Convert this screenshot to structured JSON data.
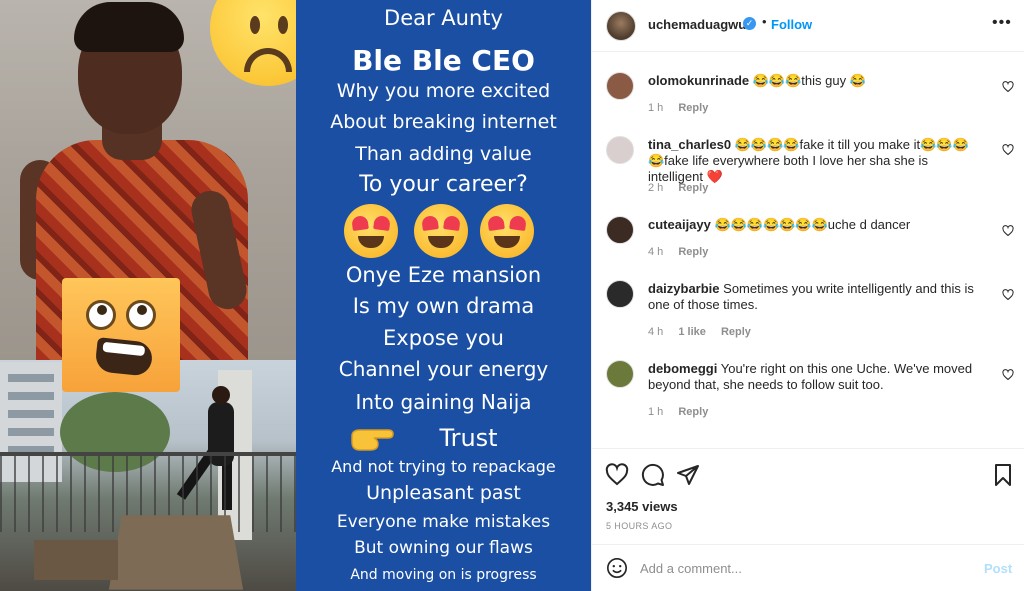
{
  "post_image": {
    "lines": [
      "Dear Aunty",
      "Ble Ble CEO",
      "Why you more excited",
      "About breaking internet",
      "Than adding value",
      "To your career?",
      "Onye Eze mansion",
      "Is my own drama",
      "Expose you",
      "Channel your energy",
      "Into gaining Naija",
      "Trust",
      "And not trying to repackage",
      "Unpleasant past",
      "Everyone make mistakes",
      "But owning our flaws",
      "And moving on is progress"
    ],
    "panel_color": "#1a4fa3"
  },
  "header": {
    "username": "uchemaduagwu",
    "verified_icon": "verified-badge-icon",
    "separator": "•",
    "follow_label": "Follow",
    "more_label": "•••"
  },
  "comments": [
    {
      "user": "olomokunrinade",
      "text": "😂😂😂this guy 😂",
      "time": "1 h",
      "likes": "",
      "reply": "Reply",
      "avatar_color": "#8a5a44"
    },
    {
      "user": "tina_charles0",
      "text": "😂😂😂😂fake it till you make it😂😂😂😂fake life everywhere both I love her sha she is intelligent ❤️",
      "time": "2 h",
      "likes": "",
      "reply": "Reply",
      "avatar_color": "#d9cfcf"
    },
    {
      "user": "cuteaijayy",
      "text": "😂😂😂😂😂😂😂uche d dancer",
      "time": "4 h",
      "likes": "",
      "reply": "Reply",
      "avatar_color": "#3b2b23"
    },
    {
      "user": "daizybarbie",
      "text": "Sometimes you write intelligently and this is one of those times.",
      "time": "4 h",
      "likes": "1 like",
      "reply": "Reply",
      "avatar_color": "#2a2a2a"
    },
    {
      "user": "debomeggi",
      "text": "You're right on this one Uche. We've moved beyond that, she needs to follow suit too.",
      "time": "1 h",
      "likes": "",
      "reply": "Reply",
      "avatar_color": "#6b7a3a"
    }
  ],
  "actions": {
    "views": "3,345 views",
    "ago": "5 HOURS AGO"
  },
  "add_comment": {
    "placeholder": "Add a comment...",
    "post_label": "Post"
  }
}
